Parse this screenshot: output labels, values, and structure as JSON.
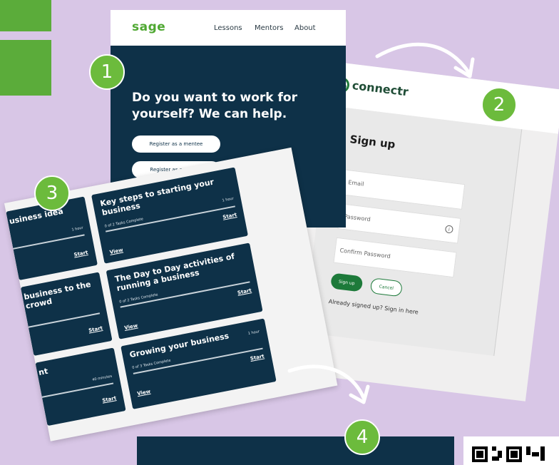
{
  "badges": [
    "1",
    "2",
    "3",
    "4"
  ],
  "colors": {
    "background": "#d8c6e6",
    "navy": "#0e3148",
    "green": "#6cbb3c",
    "connectr_green": "#1d7a3a"
  },
  "sage": {
    "logo": "sage",
    "nav": [
      "Lessons",
      "Mentors",
      "About"
    ],
    "headline": "Do you want to work for yourself? We can help.",
    "buttons": [
      "Register as a mentee",
      "Register as a mentor"
    ]
  },
  "connectr": {
    "logo": "connectr",
    "title": "Sign up",
    "fields": [
      "Email",
      "Password",
      "Confirm Password"
    ],
    "signup_button": "Sign up",
    "cancel_button": "Cancel",
    "signin_text": "Already signed up? Sign in here"
  },
  "lessons": {
    "tiles": [
      {
        "title": "usiness idea",
        "tasks": "",
        "duration": "1 hour",
        "view": "",
        "start": "Start"
      },
      {
        "title": "Key steps to starting your business",
        "tasks": "0 of 2 Tasks Complete",
        "duration": "1 hour",
        "view": "View",
        "start": "Start"
      },
      {
        "title": "business to the crowd",
        "tasks": "",
        "duration": "",
        "view": "",
        "start": "Start"
      },
      {
        "title": "The Day to Day activities of running a business",
        "tasks": "0 of 2 Tasks Complete",
        "duration": "",
        "view": "View",
        "start": "Start"
      },
      {
        "title": "nt",
        "tasks": "",
        "duration": "40 minutes",
        "view": "",
        "start": "Start"
      },
      {
        "title": "Growing your business",
        "tasks": "0 of 3 Tasks Complete",
        "duration": "1 hour",
        "view": "View",
        "start": "Start"
      }
    ]
  }
}
